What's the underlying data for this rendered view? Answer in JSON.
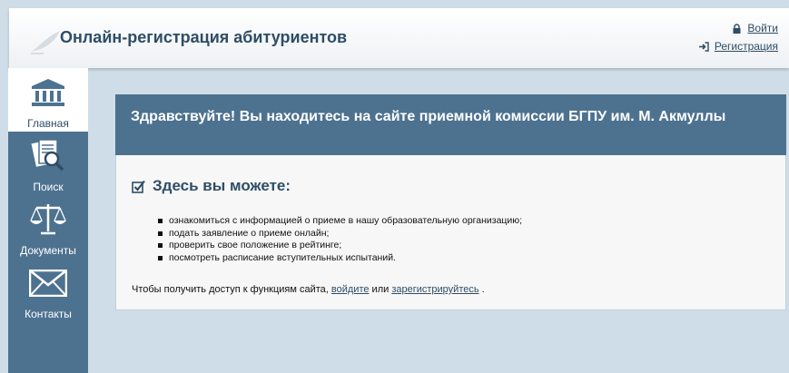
{
  "header": {
    "title": "Онлайн-регистрация абитуриентов",
    "login_label": "Войти",
    "register_label": "Регистрация"
  },
  "sidebar": {
    "items": [
      {
        "label": "Главная",
        "icon": "institution-icon",
        "active": true
      },
      {
        "label": "Поиск",
        "icon": "document-search-icon",
        "active": false
      },
      {
        "label": "Документы",
        "icon": "scales-icon",
        "active": false
      },
      {
        "label": "Контакты",
        "icon": "envelope-icon",
        "active": false
      }
    ]
  },
  "main": {
    "heading": "Здравствуйте! Вы находитесь на сайте приемной комиссии БГПУ им. М. Акмуллы",
    "can_title": "Здесь вы можете:",
    "list": [
      "ознакомиться с информацией о приеме в нашу образовательную организацию;",
      "подать заявление о приеме онлайн;",
      "проверить свое положение в рейтинге;",
      "посмотреть расписание вступительных испытаний."
    ],
    "note_prefix": "Чтобы получить доступ к функциям сайта,",
    "note_login": "войдите",
    "note_or": "или",
    "note_register": "зарегистрируйтесь",
    "note_end": "."
  },
  "colors": {
    "accent": "#4d7290",
    "title_text": "#2e4d66",
    "page_bg": "#cfdde8"
  }
}
